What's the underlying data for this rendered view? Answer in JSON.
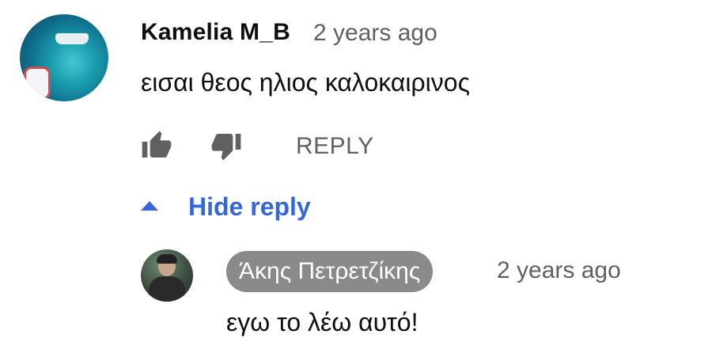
{
  "comment": {
    "author": "Kamelia M_B",
    "time": "2 years ago",
    "text": "εισαι θεος ηλιος καλοκαιρινος",
    "actions": {
      "like_icon": "thumbs-up-icon",
      "dislike_icon": "thumbs-down-icon",
      "reply_label": "REPLY"
    }
  },
  "replies_toggle": {
    "icon": "caret-up-icon",
    "label": "Hide reply",
    "color": "#3567d8"
  },
  "reply": {
    "author": "Άκης Πετρετζίκης",
    "author_chip_color": "#8a8a8a",
    "time": "2 years ago",
    "text": "εγω το λέω αυτό!"
  }
}
